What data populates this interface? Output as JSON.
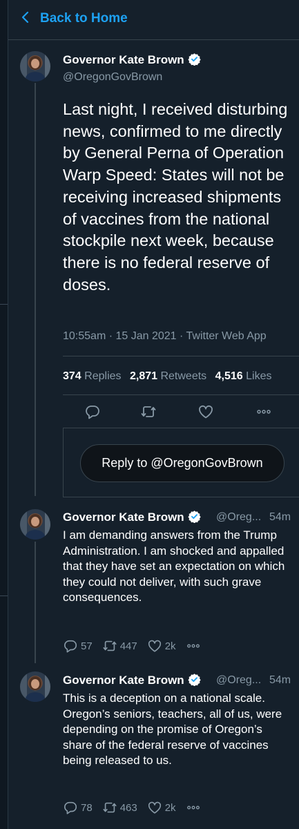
{
  "header": {
    "back_label": "Back to Home"
  },
  "main_tweet": {
    "author_name": "Governor Kate Brown",
    "handle": "@OregonGovBrown",
    "text": "Last night, I received disturbing news, confirmed to me directly by General Perna of Operation Warp Speed: States will not be receiving increased shipments of vaccines from the national stockpile next week, because there is no federal reserve of doses.",
    "meta": "10:55am · 15 Jan 2021 · Twitter Web App",
    "stats": {
      "replies_count": "374",
      "replies_label": "Replies",
      "retweets_count": "2,871",
      "retweets_label": "Retweets",
      "likes_count": "4,516",
      "likes_label": "Likes"
    }
  },
  "reply_box": {
    "label": "Reply to @OregonGovBrown"
  },
  "thread": [
    {
      "author_name": "Governor Kate Brown",
      "handle": "@Oreg...",
      "time": "54m",
      "text": "I am demanding answers from the Trump Administration. I am shocked and appalled that they have set an expectation on which they could not deliver, with such grave consequences.",
      "replies": "57",
      "retweets": "447",
      "likes": "2k"
    },
    {
      "author_name": "Governor Kate Brown",
      "handle": "@Oreg...",
      "time": "54m",
      "text": "This is a deception on a national scale. Oregon’s seniors, teachers, all of us, were depending on the promise of Oregon’s share of the federal reserve of vaccines being released to us.",
      "replies": "78",
      "retweets": "463",
      "likes": "2k"
    }
  ],
  "icons": {
    "back": "chevron-left-icon",
    "verified": "verified-badge-icon",
    "reply": "reply-icon",
    "retweet": "retweet-icon",
    "like": "heart-icon",
    "more": "more-icon"
  },
  "colors": {
    "background": "#15202b",
    "accent": "#1da1f2",
    "secondary_text": "#8899a6",
    "border": "#38444d"
  }
}
